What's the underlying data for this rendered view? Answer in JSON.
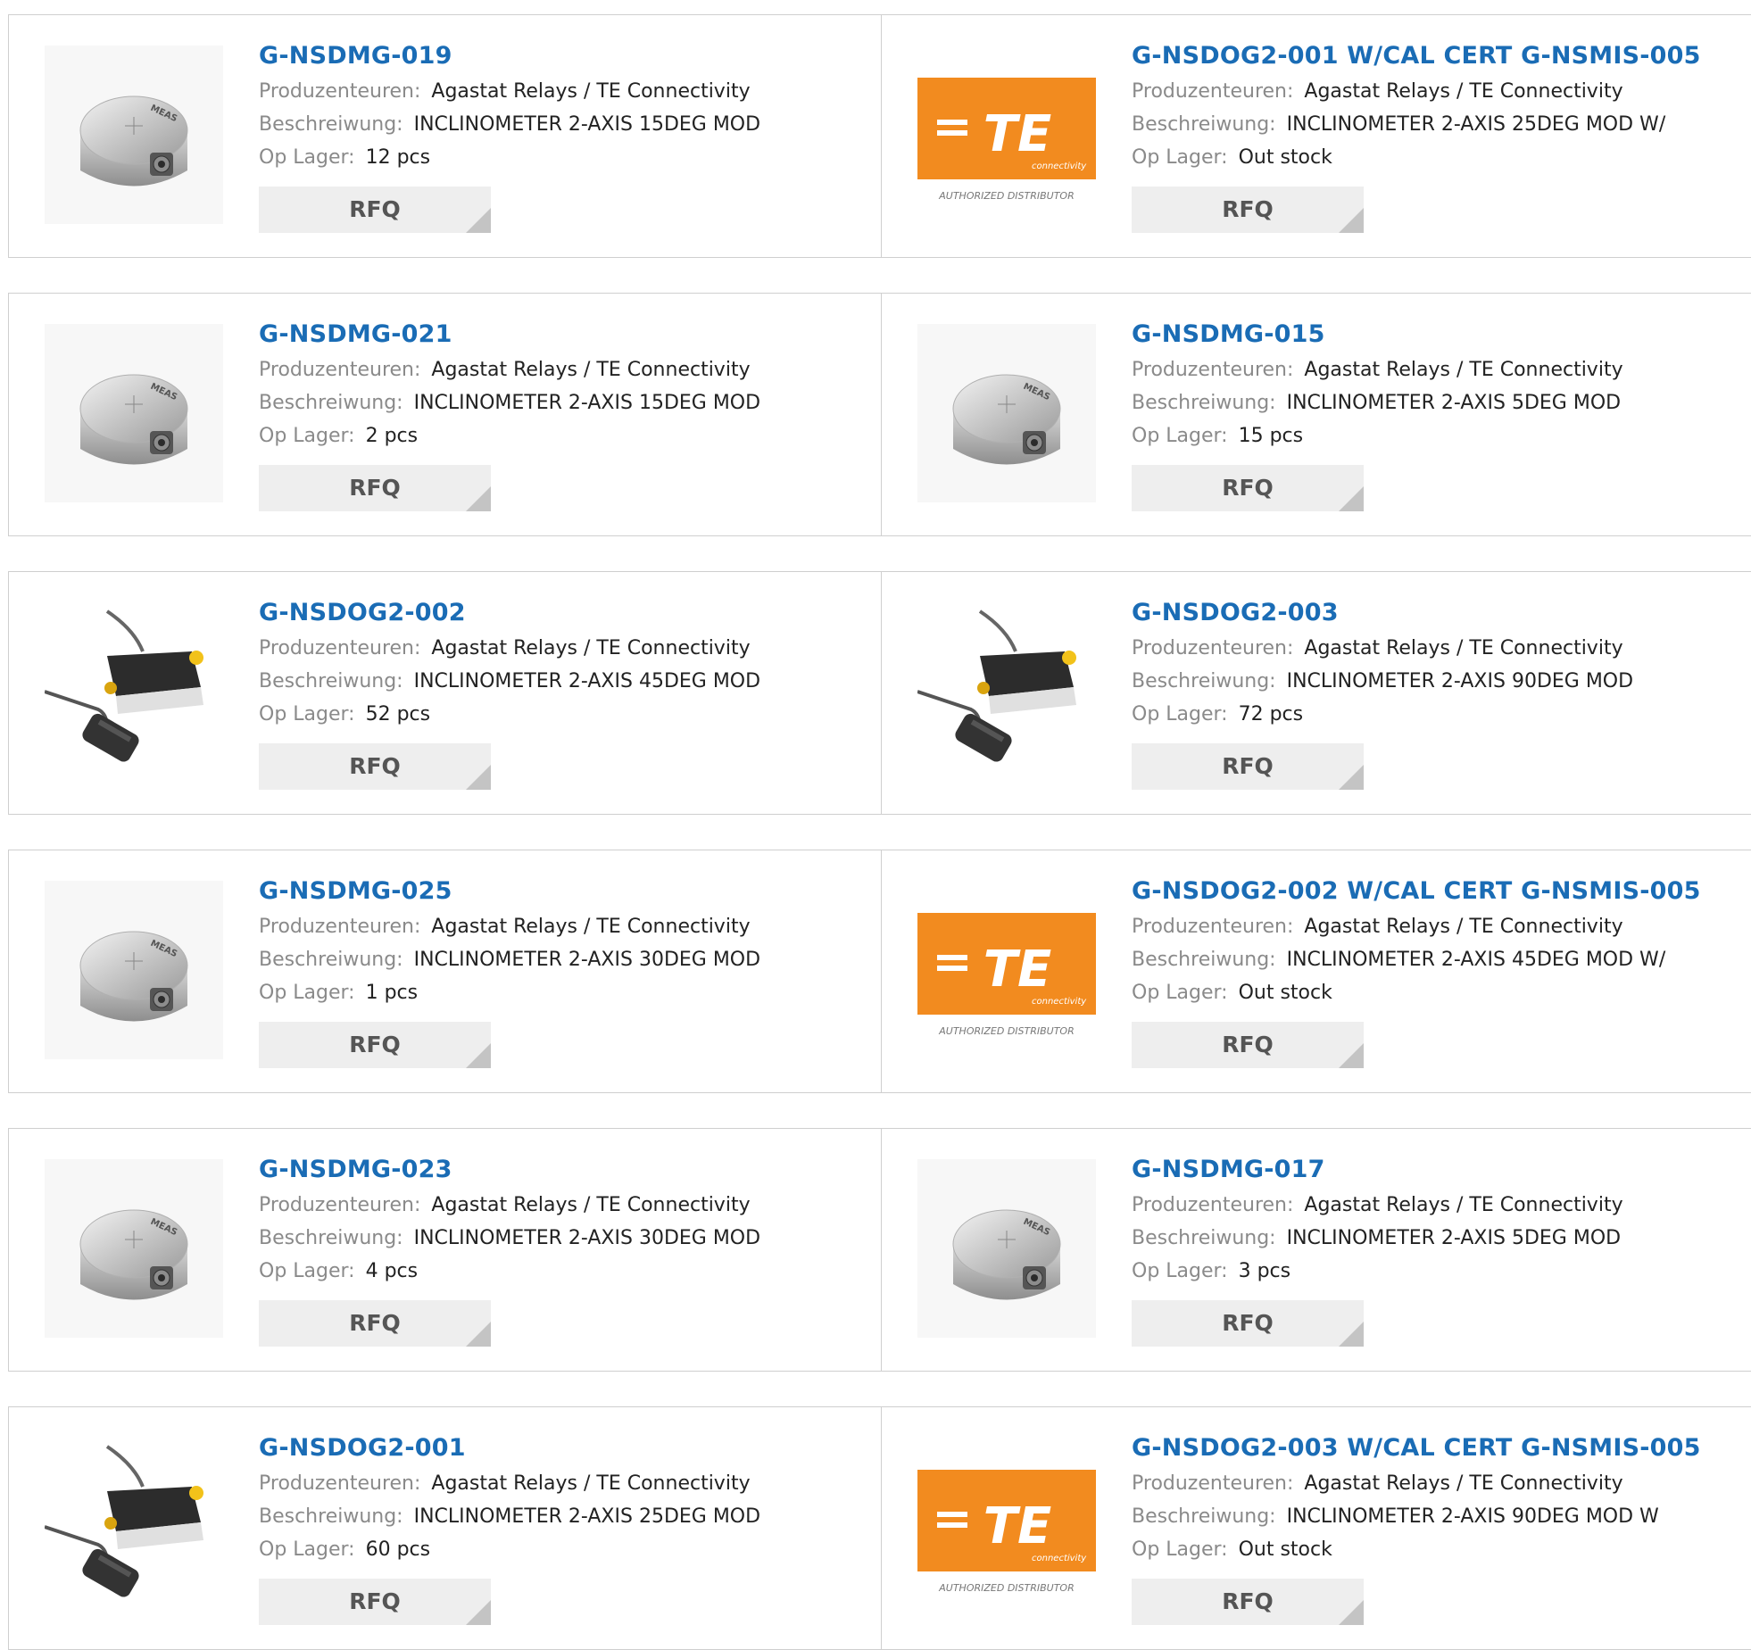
{
  "labels": {
    "manufacturer": "Produzenteuren:",
    "description": "Beschreiwung:",
    "stock": "Op Lager:",
    "rfq": "RFQ"
  },
  "colors": {
    "title": "#1a6cb5",
    "te_orange": "#f28b1f",
    "rfq_bg": "#eeeeee"
  },
  "te_logo": {
    "text": "TE",
    "sub": "connectivity",
    "caption": "AUTHORIZED DISTRIBUTOR"
  },
  "sensor_label": "MEAS",
  "products": [
    {
      "part": "G-NSDMG-019",
      "manufacturer": "Agastat Relays / TE Connectivity",
      "description": "INCLINOMETER 2-AXIS 15DEG MOD",
      "stock": "12 pcs",
      "image": "meas-sensor-icon"
    },
    {
      "part": "G-NSDOG2-001 W/CAL CERT G-NSMIS-005",
      "manufacturer": "Agastat Relays / TE Connectivity",
      "description": "INCLINOMETER 2-AXIS 25DEG MOD W/",
      "stock": "Out stock",
      "image": "te-logo"
    },
    {
      "part": "G-NSDMG-021",
      "manufacturer": "Agastat Relays / TE Connectivity",
      "description": "INCLINOMETER 2-AXIS 15DEG MOD",
      "stock": "2 pcs",
      "image": "meas-sensor-icon"
    },
    {
      "part": "G-NSDMG-015",
      "manufacturer": "Agastat Relays / TE Connectivity",
      "description": "INCLINOMETER 2-AXIS 5DEG MOD",
      "stock": "15 pcs",
      "image": "meas-sensor-icon"
    },
    {
      "part": "G-NSDOG2-002",
      "manufacturer": "Agastat Relays / TE Connectivity",
      "description": "INCLINOMETER 2-AXIS 45DEG MOD",
      "stock": "52 pcs",
      "image": "cable-sensor-icon"
    },
    {
      "part": "G-NSDOG2-003",
      "manufacturer": "Agastat Relays / TE Connectivity",
      "description": "INCLINOMETER 2-AXIS 90DEG MOD",
      "stock": "72 pcs",
      "image": "cable-sensor-icon"
    },
    {
      "part": "G-NSDMG-025",
      "manufacturer": "Agastat Relays / TE Connectivity",
      "description": "INCLINOMETER 2-AXIS 30DEG MOD",
      "stock": "1 pcs",
      "image": "meas-sensor-icon"
    },
    {
      "part": "G-NSDOG2-002 W/CAL CERT G-NSMIS-005",
      "manufacturer": "Agastat Relays / TE Connectivity",
      "description": "INCLINOMETER 2-AXIS 45DEG MOD W/",
      "stock": "Out stock",
      "image": "te-logo"
    },
    {
      "part": "G-NSDMG-023",
      "manufacturer": "Agastat Relays / TE Connectivity",
      "description": "INCLINOMETER 2-AXIS 30DEG MOD",
      "stock": "4 pcs",
      "image": "meas-sensor-icon"
    },
    {
      "part": "G-NSDMG-017",
      "manufacturer": "Agastat Relays / TE Connectivity",
      "description": "INCLINOMETER 2-AXIS 5DEG MOD",
      "stock": "3 pcs",
      "image": "meas-sensor-icon"
    },
    {
      "part": "G-NSDOG2-001",
      "manufacturer": "Agastat Relays / TE Connectivity",
      "description": "INCLINOMETER 2-AXIS 25DEG MOD",
      "stock": "60 pcs",
      "image": "cable-sensor-icon"
    },
    {
      "part": "G-NSDOG2-003 W/CAL CERT G-NSMIS-005",
      "manufacturer": "Agastat Relays / TE Connectivity",
      "description": "INCLINOMETER 2-AXIS 90DEG MOD W",
      "stock": "Out stock",
      "image": "te-logo"
    }
  ]
}
